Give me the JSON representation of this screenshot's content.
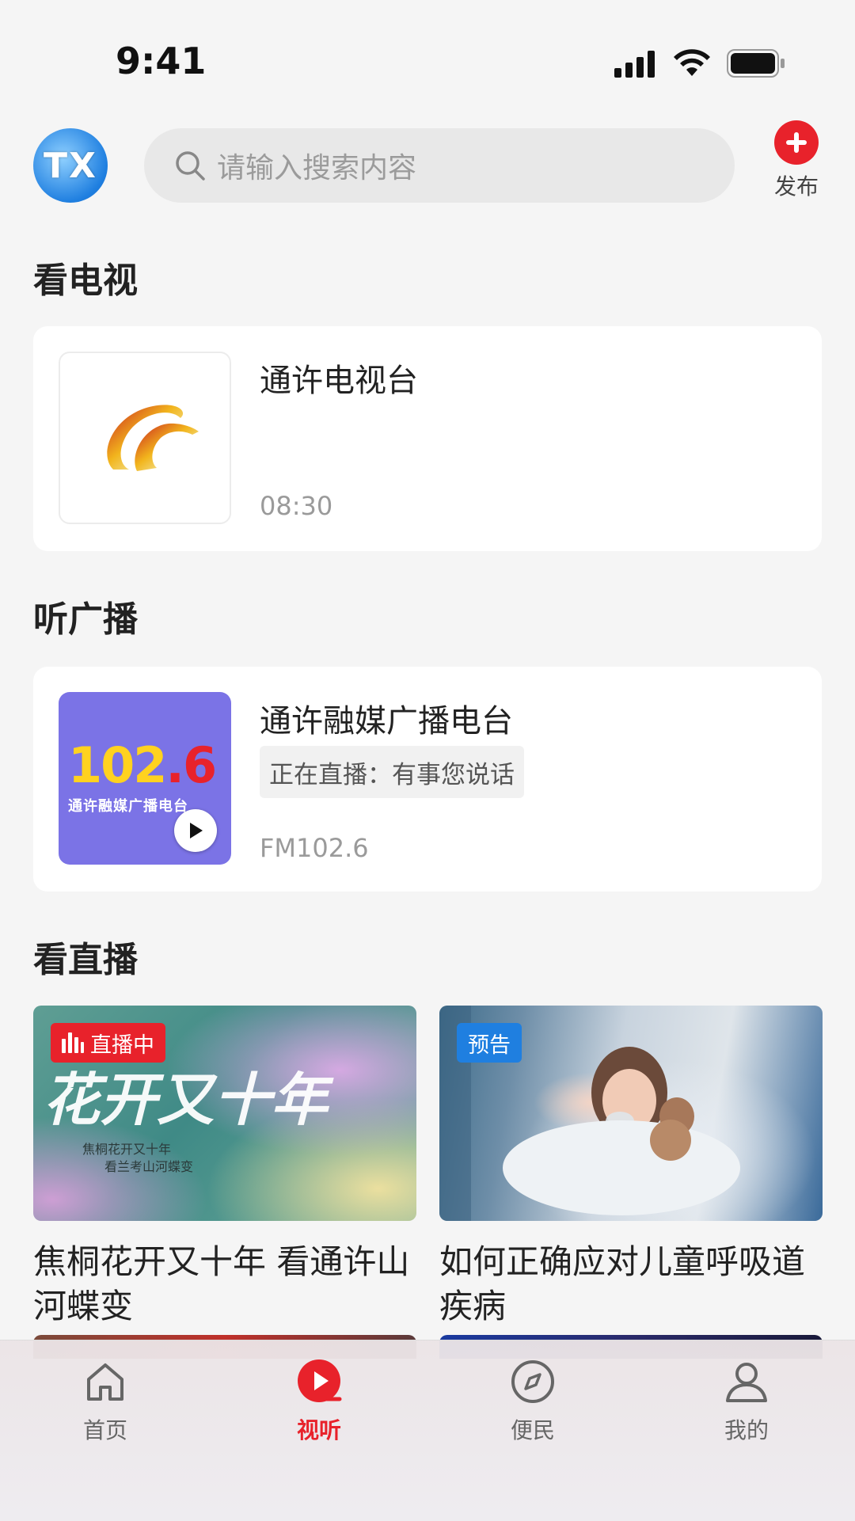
{
  "status_bar": {
    "time": "9:41"
  },
  "header": {
    "avatar_text": "TX",
    "search_placeholder": "请输入搜索内容",
    "publish_label": "发布"
  },
  "tv_section": {
    "title": "看电视",
    "channel": {
      "name": "通许电视台",
      "time": "08:30"
    }
  },
  "radio_section": {
    "title": "听广播",
    "station": {
      "name": "通许融媒广播电台",
      "now_playing": "正在直播：有事您说话",
      "frequency": "FM102.6",
      "logo_number": "102",
      "logo_decimal": ".6",
      "logo_caption": "通许融媒广播电台"
    }
  },
  "live_section": {
    "title": "看直播",
    "items": [
      {
        "badge": "直播中",
        "title": "焦桐花开又十年 看通许山河蝶变",
        "img_text": "花开又十年",
        "img_line1": "焦桐花开又十年",
        "img_line2": "看兰考山河蝶变"
      },
      {
        "badge": "预告",
        "title": "如何正确应对儿童呼吸道疾病"
      }
    ]
  },
  "tab_bar": {
    "items": [
      {
        "label": "首页",
        "icon": "home-icon",
        "active": false
      },
      {
        "label": "视听",
        "icon": "play-icon",
        "active": true
      },
      {
        "label": "便民",
        "icon": "compass-icon",
        "active": false
      },
      {
        "label": "我的",
        "icon": "user-icon",
        "active": false
      }
    ]
  },
  "colors": {
    "accent": "#e8222b",
    "preview": "#1f7fe0",
    "radio_bg": "#7b73e6"
  }
}
